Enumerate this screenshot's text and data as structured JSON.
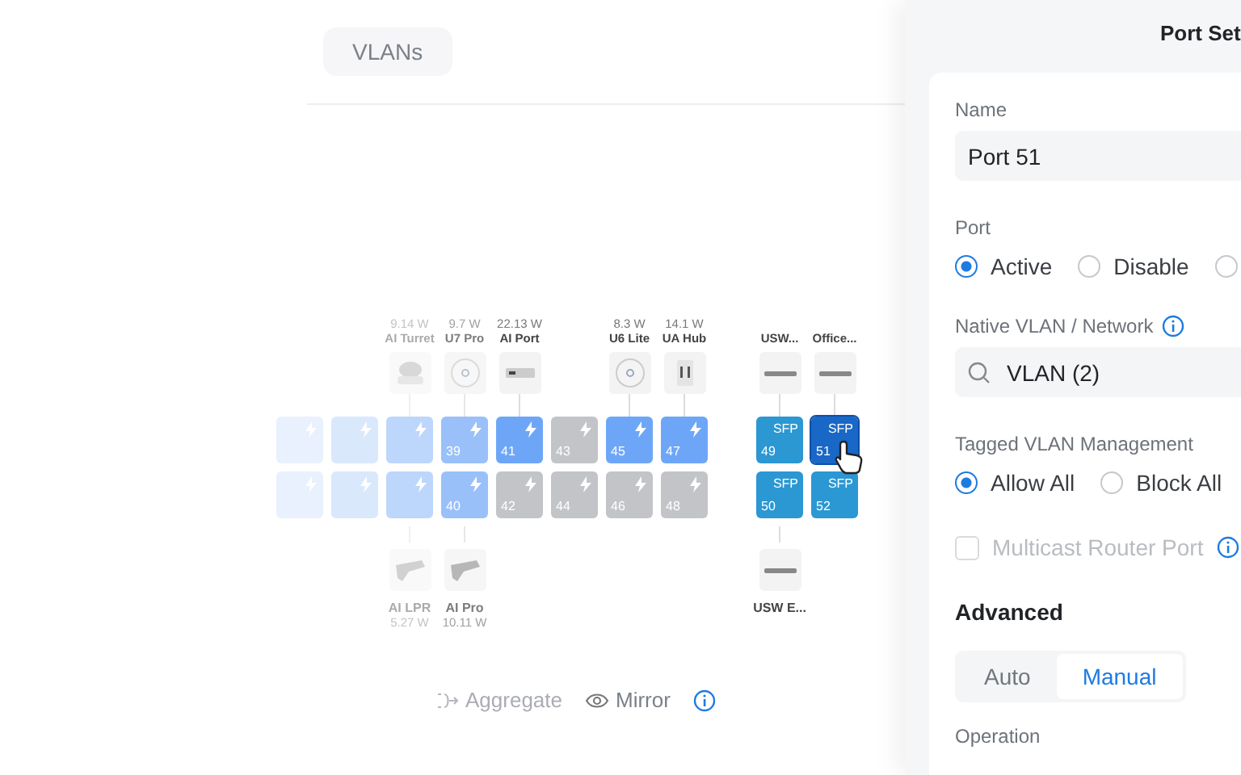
{
  "tabs": [
    {
      "label": "VLANs",
      "selected": true
    }
  ],
  "port_map": {
    "columns": [
      {
        "ports": [
          {
            "kind": "poe",
            "active": true,
            "selected": false
          },
          {
            "kind": "poe",
            "active": true,
            "selected": false
          }
        ]
      },
      {
        "ports": [
          {
            "kind": "poe",
            "active": true,
            "selected": false
          },
          {
            "kind": "poe",
            "active": true,
            "selected": false
          }
        ]
      },
      {
        "top_device": {
          "kind": "camera",
          "power": "9.14 W",
          "name": "AI Turret"
        },
        "ports": [
          {
            "kind": "poe",
            "active": true,
            "selected": false
          },
          {
            "kind": "poe",
            "active": true,
            "selected": false
          }
        ],
        "bottom_device": {
          "kind": "camera-bullet",
          "name": "AI LPR",
          "power": "5.27 W"
        }
      },
      {
        "top_device": {
          "kind": "ap",
          "power": "9.7 W",
          "name": "U7 Pro"
        },
        "ports": [
          {
            "kind": "poe",
            "number": "39",
            "active": true,
            "selected": false
          },
          {
            "kind": "poe",
            "number": "40",
            "active": true,
            "selected": false
          }
        ],
        "bottom_device": {
          "kind": "camera-bullet",
          "name": "AI Pro",
          "power": "10.11 W"
        }
      },
      {
        "top_device": {
          "kind": "bar",
          "power": "22.13 W",
          "name": "AI Port"
        },
        "ports": [
          {
            "kind": "poe",
            "number": "41",
            "active": true,
            "selected": false
          },
          {
            "kind": "poe",
            "number": "42",
            "active": false,
            "selected": false
          }
        ]
      },
      {
        "ports": [
          {
            "kind": "poe",
            "number": "43",
            "active": false,
            "selected": false
          },
          {
            "kind": "poe",
            "number": "44",
            "active": false,
            "selected": false
          }
        ]
      },
      {
        "top_device": {
          "kind": "ap",
          "power": "8.3 W",
          "name": "U6 Lite"
        },
        "ports": [
          {
            "kind": "poe",
            "number": "45",
            "active": true,
            "selected": false
          },
          {
            "kind": "poe",
            "number": "46",
            "active": false,
            "selected": false
          }
        ]
      },
      {
        "top_device": {
          "kind": "hub",
          "power": "14.1 W",
          "name": "UA Hub"
        },
        "ports": [
          {
            "kind": "poe",
            "number": "47",
            "active": true,
            "selected": false
          },
          {
            "kind": "poe",
            "number": "48",
            "active": false,
            "selected": false
          }
        ]
      }
    ],
    "sfp_columns": [
      {
        "top_device": {
          "kind": "switch",
          "name": "USW..."
        },
        "ports": [
          {
            "kind": "sfp",
            "label": "SFP",
            "number": "49",
            "selected": false
          },
          {
            "kind": "sfp",
            "label": "SFP",
            "number": "50",
            "selected": false
          }
        ],
        "bottom_device": {
          "kind": "switch",
          "name": "USW E..."
        }
      },
      {
        "top_device": {
          "kind": "switch",
          "name": "Office..."
        },
        "ports": [
          {
            "kind": "sfp",
            "label": "SFP",
            "number": "51",
            "selected": true
          },
          {
            "kind": "sfp",
            "label": "SFP",
            "number": "52",
            "selected": false
          }
        ]
      }
    ]
  },
  "toolbar": [
    {
      "kind": "aggregate",
      "label": "Aggregate"
    },
    {
      "kind": "mirror",
      "label": "Mirror",
      "info": true
    }
  ],
  "panel": {
    "title": "Port Set",
    "name_field": {
      "label": "Name",
      "value": "Port 51"
    },
    "port_state": {
      "label": "Port",
      "options": [
        {
          "label": "Active",
          "selected": true
        },
        {
          "label": "Disable",
          "selected": false
        },
        {
          "selected": false
        }
      ]
    },
    "native_vlan": {
      "label": "Native VLAN / Network",
      "value": "VLAN (2)"
    },
    "tagged_vlan": {
      "label": "Tagged VLAN Management",
      "options": [
        {
          "label": "Allow All",
          "selected": true
        },
        {
          "label": "Block All",
          "selected": false
        }
      ]
    },
    "multicast": {
      "label": "Multicast Router Port",
      "checked": false,
      "disabled": true
    },
    "advanced": {
      "title": "Advanced",
      "modes": [
        {
          "label": "Auto",
          "selected": false
        },
        {
          "label": "Manual",
          "selected": true
        }
      ]
    },
    "operation_label": "Operation"
  }
}
